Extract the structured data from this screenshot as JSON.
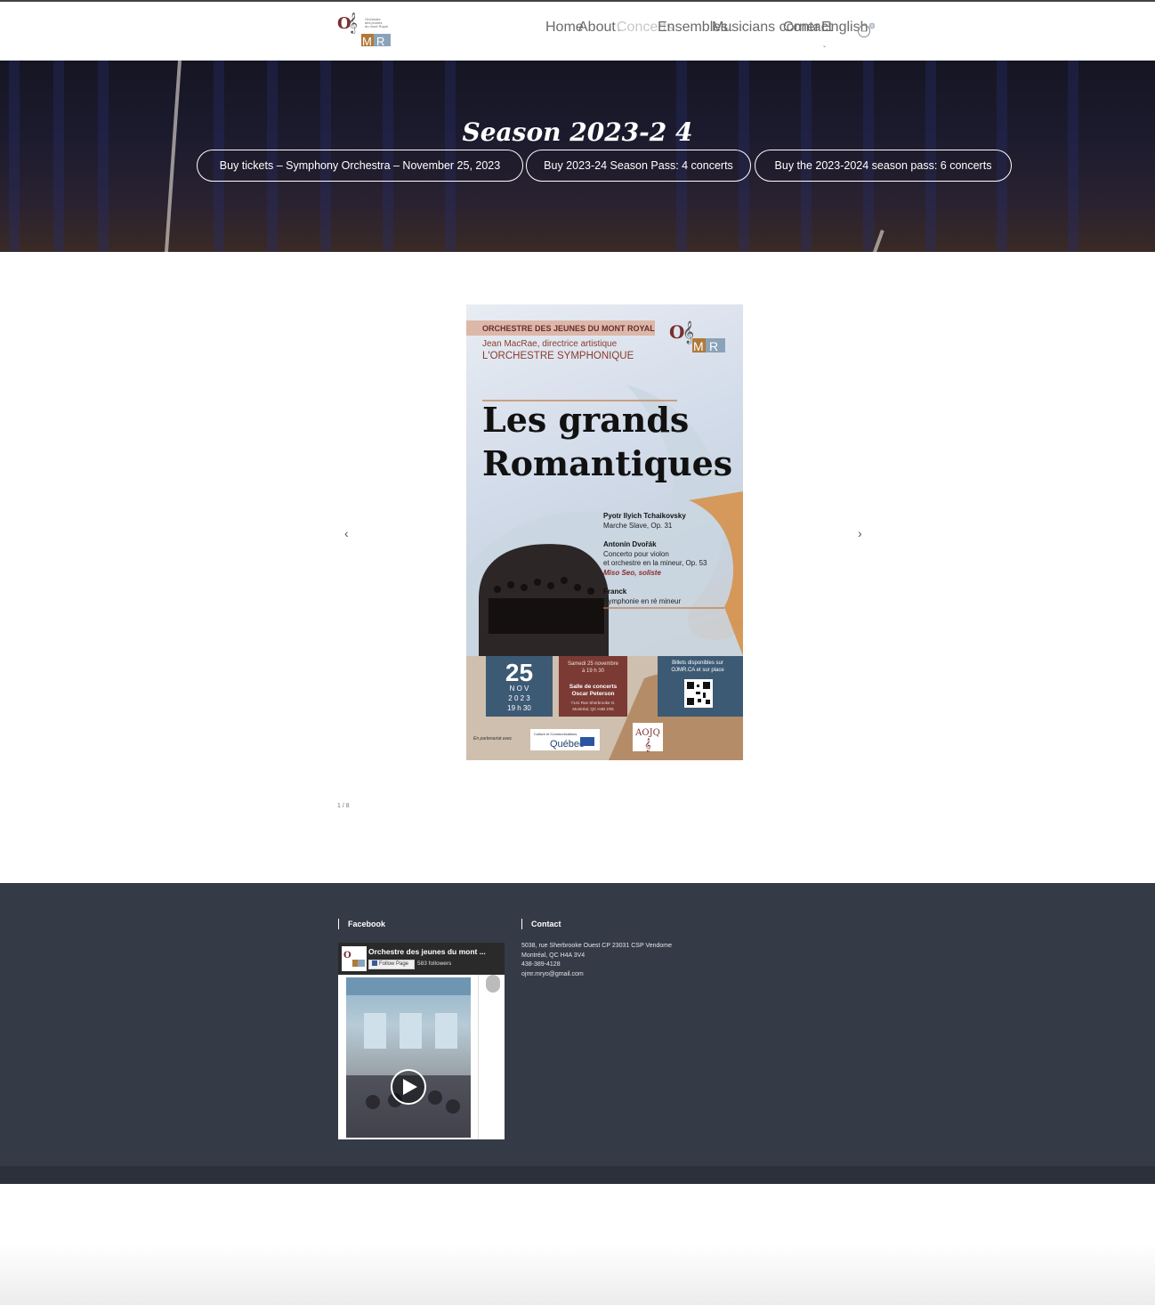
{
  "nav": {
    "home": "Home",
    "about": "About",
    "concerts": "Concerts",
    "ensembles": "Ensembles",
    "musicians_corner": "Musicians corner",
    "contact": "Contact",
    "language": "English",
    "cart_count": "0"
  },
  "hero": {
    "title": "Season 2023-2 4",
    "buttons": [
      "Buy tickets – Symphony Orchestra – November 25, 2023",
      "Buy 2023-24 Season Pass: 4 concerts",
      "Buy the 2023-2024 season pass: 6 concerts"
    ]
  },
  "poster": {
    "org": "ORCHESTRE DES JEUNES DU MONT ROYAL",
    "director": "Jean MacRae, directrice artistique",
    "ensemble": "L'ORCHESTRE SYMPHONIQUE",
    "title_line1": "Les grands",
    "title_line2": "Romantiques",
    "program": [
      {
        "composer": "Pyotr Ilyich Tchaikovsky",
        "works": [
          "Marche Slave, Op. 31"
        ]
      },
      {
        "composer": "Antonín Dvořák",
        "works": [
          "Concerto pour violon",
          "et orchestre en la mineur, Op. 53"
        ],
        "soloist": "Miso Seo, soliste"
      },
      {
        "composer": "Franck",
        "works": [
          "Symphonie en ré mineur"
        ]
      }
    ],
    "day": "25",
    "month": "N O V",
    "year": "2 0 2 3",
    "time": "19 h 30",
    "date_text_1": "Samedi 25 novembre",
    "date_text_2": "à 19 h 30",
    "venue_1": "Salle de concerts",
    "venue_2": "Oscar Peterson",
    "address_1": "7141 Rue Sherbrooke O.",
    "address_2": "Montréal, QC H4B 1R6",
    "tickets_1": "Billets disponibles sur",
    "tickets_2": "OJMR.CA et sur place",
    "partner": "En partenariat avec",
    "quebec_small": "Culture et Communications",
    "quebec": "Québec",
    "aojq": "AOJQ"
  },
  "slider": {
    "counter": "1 / 8"
  },
  "footer": {
    "facebook_heading": "Facebook",
    "fb_page_name": "Orchestre des jeunes du mont ...",
    "fb_follow": "Follow Page",
    "fb_followers": "583 followers",
    "contact_heading": "Contact",
    "contact_lines": [
      "5038, rue Sherbrooke Ouest CP 23031 CSP Vendome",
      "Montréal, QC H4A 3V4",
      "438-389-4128",
      "ojmr.mryo@gmail.com"
    ]
  },
  "colors": {
    "footer_bg": "#343a46",
    "logo_red": "#7a2e2e",
    "logo_gold": "#b07a3a",
    "logo_blue": "#8aa3b8",
    "poster_red": "#7b3a34",
    "poster_blue": "#3d5a75"
  }
}
